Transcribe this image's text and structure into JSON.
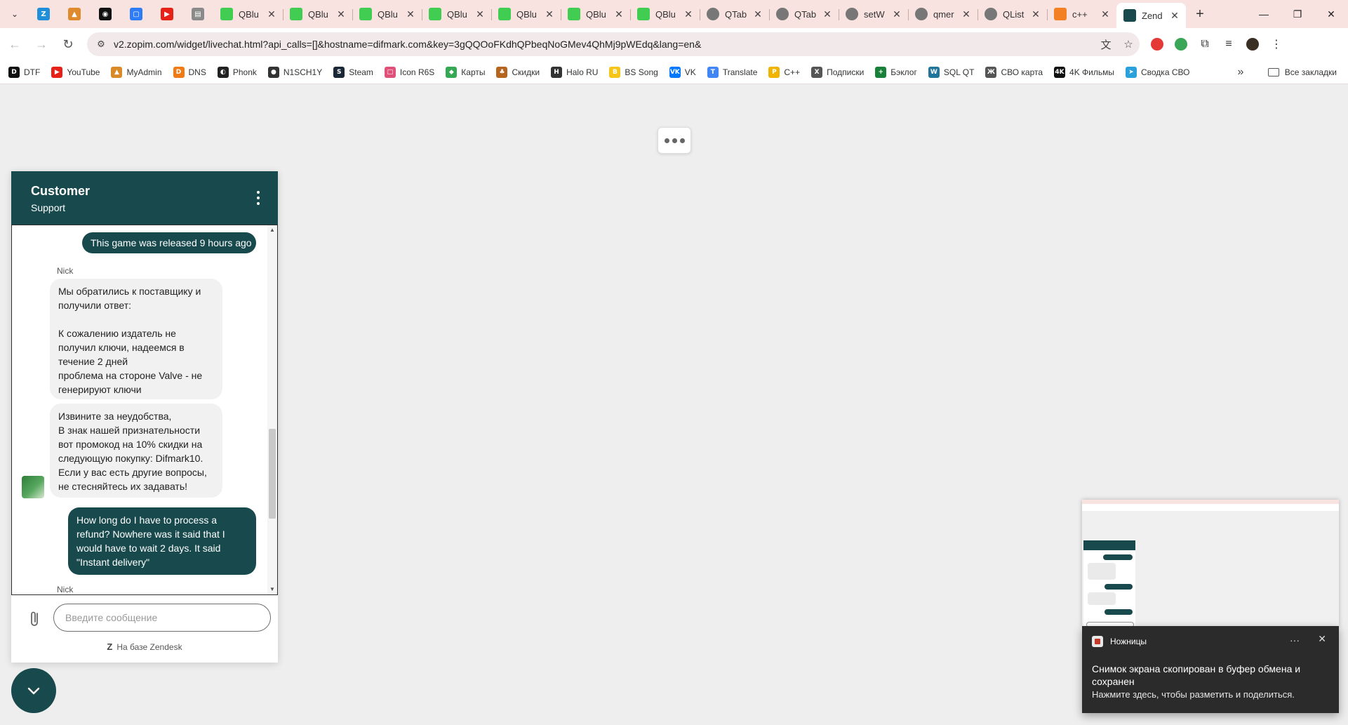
{
  "browser": {
    "tabs": [
      {
        "title": "QBlu",
        "icon": "qt-icon",
        "color": "#41cd52"
      },
      {
        "title": "QBlu",
        "icon": "qt-icon",
        "color": "#41cd52"
      },
      {
        "title": "QBlu",
        "icon": "qt-icon",
        "color": "#41cd52"
      },
      {
        "title": "QBlu",
        "icon": "qt-icon",
        "color": "#41cd52"
      },
      {
        "title": "QBlu",
        "icon": "qt-icon",
        "color": "#41cd52"
      },
      {
        "title": "QBlu",
        "icon": "qt-icon",
        "color": "#41cd52"
      },
      {
        "title": "QBlu",
        "icon": "qt-icon",
        "color": "#41cd52"
      },
      {
        "title": "QTab",
        "icon": "google-icon",
        "color": "#777777"
      },
      {
        "title": "QTab",
        "icon": "google-icon",
        "color": "#777777"
      },
      {
        "title": "setW",
        "icon": "google-icon",
        "color": "#777777"
      },
      {
        "title": "qmer",
        "icon": "google-icon",
        "color": "#777777"
      },
      {
        "title": "QList",
        "icon": "google-icon",
        "color": "#777777"
      },
      {
        "title": "c++",
        "icon": "stackoverflow-icon",
        "color": "#f48024"
      },
      {
        "title": "Zend",
        "icon": "zendesk-icon",
        "color": "#17494d",
        "active": true
      }
    ],
    "pinned_tabs": [
      {
        "icon": "z-app-icon",
        "label": "Z",
        "color": "#1f8fd9"
      },
      {
        "icon": "mountain-app-icon",
        "label": "▲",
        "color": "#e08a2e"
      },
      {
        "icon": "pc-app-icon",
        "label": "◉",
        "color": "#111111"
      },
      {
        "icon": "chat-app-icon",
        "label": "▢",
        "color": "#2e7cf6"
      },
      {
        "icon": "youtube-icon",
        "label": "▶",
        "color": "#e62117"
      },
      {
        "icon": "doc-app-icon",
        "label": "▤",
        "color": "#8a8a8a"
      }
    ],
    "url": "v2.zopim.com/widget/livechat.html?api_calls=[]&hostname=difmark.com&key=3gQQOoFKdhQPbeqNoGMev4QhMj9pWEdq&lang=en&",
    "bookmarks": [
      {
        "label": "DTF",
        "icon": "D",
        "color": "#111111"
      },
      {
        "label": "YouTube",
        "icon": "▶",
        "color": "#e62117"
      },
      {
        "label": "MyAdmin",
        "icon": "▲",
        "color": "#d98b2a"
      },
      {
        "label": "DNS",
        "icon": "D",
        "color": "#f07a14"
      },
      {
        "label": "Phonk",
        "icon": "◐",
        "color": "#222222"
      },
      {
        "label": "N1SCH1Y",
        "icon": "●",
        "color": "#333333"
      },
      {
        "label": "Steam",
        "icon": "S",
        "color": "#1b2838"
      },
      {
        "label": "Icon R6S",
        "icon": "□",
        "color": "#e0517a"
      },
      {
        "label": "Карты",
        "icon": "◆",
        "color": "#34a853"
      },
      {
        "label": "Скидки",
        "icon": "♣",
        "color": "#b5651d"
      },
      {
        "label": "Halo RU",
        "icon": "H",
        "color": "#333333"
      },
      {
        "label": "BS Song",
        "icon": "B",
        "color": "#f5c518"
      },
      {
        "label": "VK",
        "icon": "VK",
        "color": "#0077ff"
      },
      {
        "label": "Translate",
        "icon": "T",
        "color": "#4285f4"
      },
      {
        "label": "C++",
        "icon": "P",
        "color": "#f0b400"
      },
      {
        "label": "Подписки",
        "icon": "X",
        "color": "#555555"
      },
      {
        "label": "Бэклог",
        "icon": "+",
        "color": "#188038"
      },
      {
        "label": "SQL QT",
        "icon": "W",
        "color": "#21759b"
      },
      {
        "label": "СВО карта",
        "icon": "Ж",
        "color": "#555555"
      },
      {
        "label": "4K Фильмы",
        "icon": "4K",
        "color": "#111111"
      },
      {
        "label": "Сводка СВО",
        "icon": "➤",
        "color": "#2aa1da"
      }
    ],
    "all_bookmarks_label": "Все закладки"
  },
  "widget": {
    "title": "Customer",
    "subtitle": "Support",
    "messages": {
      "m1": "This game was released 9 hours ago",
      "agent_name_1": "Nick",
      "m2": "Мы обратились к поставщику и\nполучили ответ:\n\nК сожалению издатель не\nполучил ключи, надеемся в\nтечение 2 дней\nпроблема на стороне Valve - не\nгенерируют ключи",
      "m3": "Извините за неудобства,\nВ знак нашей признательности\nвот промокод на 10% скидки на\nследующую покупку: Difmark10.\nЕсли у вас есть другие вопросы,\nне стесняйтесь их задавать!",
      "m4": "How long do I have to process a refund? Nowhere was it said that I would have to wait 2 days. It said \"Instant delivery\"",
      "agent_name_2": "Nick"
    },
    "input_placeholder": "Введите сообщение",
    "powered_by": "На базе Zendesk"
  },
  "toast": {
    "app_name": "Ножницы",
    "title": "Снимок экрана скопирован в буфер обмена и сохранен",
    "text": "Нажмите здесь, чтобы разметить и поделиться."
  },
  "colors": {
    "brand": "#17494d",
    "tabstrip": "#f9e3e1"
  }
}
